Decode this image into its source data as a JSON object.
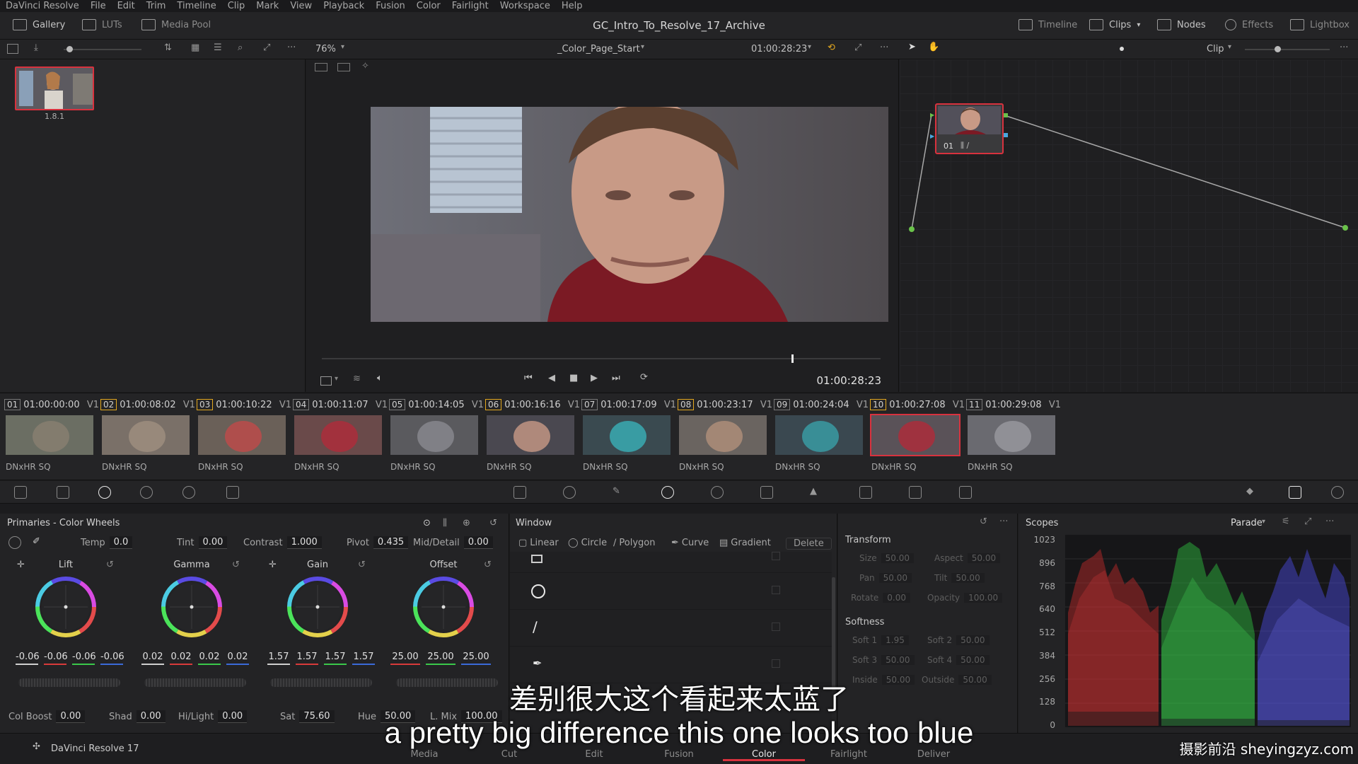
{
  "menubar": {
    "items": [
      "DaVinci Resolve",
      "File",
      "Edit",
      "Trim",
      "Timeline",
      "Clip",
      "Mark",
      "View",
      "Playback",
      "Fusion",
      "Color",
      "Fairlight",
      "Workspace",
      "Help"
    ]
  },
  "header": {
    "project_title": "GC_Intro_To_Resolve_17_Archive",
    "left_buttons": [
      "Gallery",
      "LUTs",
      "Media Pool"
    ],
    "right_buttons": [
      "Timeline",
      "Clips",
      "Nodes",
      "Effects",
      "Lightbox"
    ]
  },
  "viewer_toolbar": {
    "zoom": "76%",
    "timeline_name": "_Color_Page_Start",
    "timecode": "01:00:28:23",
    "node_mode": "Clip"
  },
  "gallery": {
    "still_label": "1.8.1"
  },
  "viewer": {
    "timecode": "01:00:28:23",
    "scrub_position": 0.84
  },
  "node_editor": {
    "node_label": "01"
  },
  "clips": [
    {
      "num": "01",
      "tc": "01:00:00:00",
      "track": "V1",
      "codec": "DNxHR SQ"
    },
    {
      "num": "02",
      "tc": "01:00:08:02",
      "track": "V1",
      "codec": "DNxHR SQ"
    },
    {
      "num": "03",
      "tc": "01:00:10:22",
      "track": "V1",
      "codec": "DNxHR SQ"
    },
    {
      "num": "04",
      "tc": "01:00:11:07",
      "track": "V1",
      "codec": "DNxHR SQ"
    },
    {
      "num": "05",
      "tc": "01:00:14:05",
      "track": "V1",
      "codec": "DNxHR SQ"
    },
    {
      "num": "06",
      "tc": "01:00:16:16",
      "track": "V1",
      "codec": "DNxHR SQ"
    },
    {
      "num": "07",
      "tc": "01:00:17:09",
      "track": "V1",
      "codec": "DNxHR SQ"
    },
    {
      "num": "08",
      "tc": "01:00:23:17",
      "track": "V1",
      "codec": "DNxHR SQ"
    },
    {
      "num": "09",
      "tc": "01:00:24:04",
      "track": "V1",
      "codec": "DNxHR SQ"
    },
    {
      "num": "10",
      "tc": "01:00:27:08",
      "track": "V1",
      "codec": "DNxHR SQ"
    },
    {
      "num": "11",
      "tc": "01:00:29:08",
      "track": "V1",
      "codec": "DNxHR SQ"
    }
  ],
  "primaries": {
    "title": "Primaries - Color Wheels",
    "temp_label": "Temp",
    "temp": "0.0",
    "tint_label": "Tint",
    "tint": "0.00",
    "contrast_label": "Contrast",
    "contrast": "1.000",
    "pivot_label": "Pivot",
    "pivot": "0.435",
    "middetail_label": "Mid/Detail",
    "middetail": "0.00",
    "wheels": [
      {
        "name": "Lift",
        "values": [
          "-0.06",
          "-0.06",
          "-0.06",
          "-0.06"
        ]
      },
      {
        "name": "Gamma",
        "values": [
          "0.02",
          "0.02",
          "0.02",
          "0.02"
        ]
      },
      {
        "name": "Gain",
        "values": [
          "1.57",
          "1.57",
          "1.57",
          "1.57"
        ]
      },
      {
        "name": "Offset",
        "values": [
          "25.00",
          "25.00",
          "25.00"
        ]
      }
    ],
    "colboost_label": "Col Boost",
    "colboost": "0.00",
    "shad_label": "Shad",
    "shad": "0.00",
    "hilight_label": "Hi/Light",
    "hilight": "0.00",
    "sat_label": "Sat",
    "sat": "75.60",
    "hue_label": "Hue",
    "hue": "50.00",
    "lmix_label": "L. Mix",
    "lmix": "100.00"
  },
  "window_panel": {
    "title": "Window",
    "tools": [
      "Linear",
      "Circle",
      "Polygon",
      "Curve",
      "Gradient"
    ],
    "delete_label": "Delete",
    "transform_label": "Transform",
    "transform": [
      {
        "label": "Size",
        "value": "50.00"
      },
      {
        "label": "Aspect",
        "value": "50.00"
      },
      {
        "label": "Pan",
        "value": "50.00"
      },
      {
        "label": "Tilt",
        "value": "50.00"
      },
      {
        "label": "Rotate",
        "value": "0.00"
      },
      {
        "label": "Opacity",
        "value": "100.00"
      }
    ],
    "softness_label": "Softness",
    "softness": [
      {
        "label": "Soft 1",
        "value": "1.95"
      },
      {
        "label": "Soft 2",
        "value": "50.00"
      },
      {
        "label": "Soft 3",
        "value": "50.00"
      },
      {
        "label": "Soft 4",
        "value": "50.00"
      },
      {
        "label": "Inside",
        "value": "50.00"
      },
      {
        "label": "Outside",
        "value": "50.00"
      }
    ]
  },
  "scopes": {
    "title": "Scopes",
    "mode": "Parade",
    "y_ticks": [
      "1023",
      "896",
      "768",
      "640",
      "512",
      "384",
      "256",
      "128",
      "0"
    ]
  },
  "page_tabs": {
    "app_label": "DaVinci Resolve 17",
    "tabs": [
      "Media",
      "Cut",
      "Edit",
      "Fusion",
      "Color",
      "Fairlight",
      "Deliver"
    ],
    "active": "Color"
  },
  "subtitles": {
    "zh": "差别很大这个看起来太蓝了",
    "en": "a pretty big difference this one looks too blue"
  },
  "watermark": "摄影前沿 sheyingzyz.com",
  "colors": {
    "accent_red": "#d8323e",
    "panel_bg": "#232325",
    "highlight_orange": "#e3a81f"
  }
}
